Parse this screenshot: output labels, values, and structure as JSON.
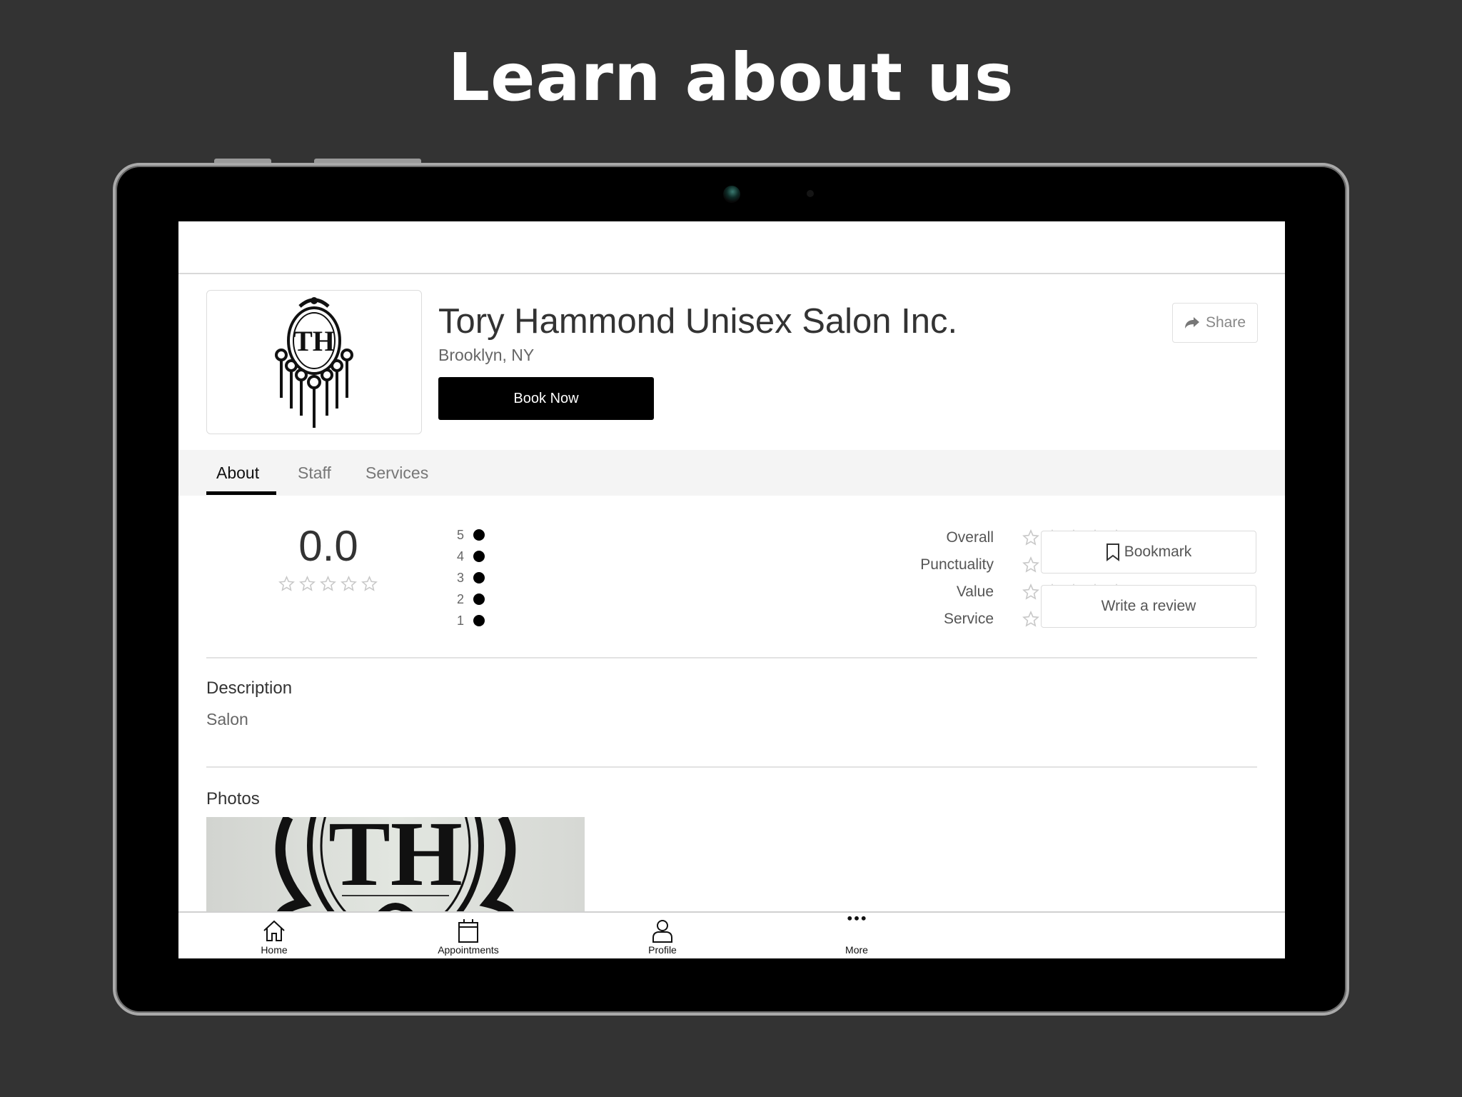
{
  "headline": "Learn about us",
  "business": {
    "name": "Tory Hammond Unisex Salon Inc.",
    "location": "Brooklyn, NY",
    "logo_monogram": "TH",
    "book_label": "Book Now",
    "share_label": "Share"
  },
  "tabs": [
    {
      "label": "About",
      "active": true
    },
    {
      "label": "Staff",
      "active": false
    },
    {
      "label": "Services",
      "active": false
    }
  ],
  "ratings": {
    "average": "0.0",
    "average_stars": 0,
    "distribution": [
      {
        "stars": "5",
        "count": 0
      },
      {
        "stars": "4",
        "count": 0
      },
      {
        "stars": "3",
        "count": 0
      },
      {
        "stars": "2",
        "count": 0
      },
      {
        "stars": "1",
        "count": 0
      }
    ],
    "categories": [
      {
        "label": "Overall",
        "stars": 0
      },
      {
        "label": "Punctuality",
        "stars": 0
      },
      {
        "label": "Value",
        "stars": 0
      },
      {
        "label": "Service",
        "stars": 0
      }
    ],
    "bookmark_label": "Bookmark",
    "review_label": "Write a review"
  },
  "description": {
    "title": "Description",
    "text": "Salon"
  },
  "photos": {
    "title": "Photos",
    "monogram": "TH"
  },
  "bottom_nav": [
    {
      "label": "Home",
      "icon": "home-icon"
    },
    {
      "label": "Appointments",
      "icon": "calendar-icon"
    },
    {
      "label": "Profile",
      "icon": "user-icon"
    },
    {
      "label": "More",
      "icon": "more-dots-icon"
    }
  ],
  "colors": {
    "background": "#333333",
    "primary_button": "#000000",
    "star_empty": "#c8c8c8"
  }
}
